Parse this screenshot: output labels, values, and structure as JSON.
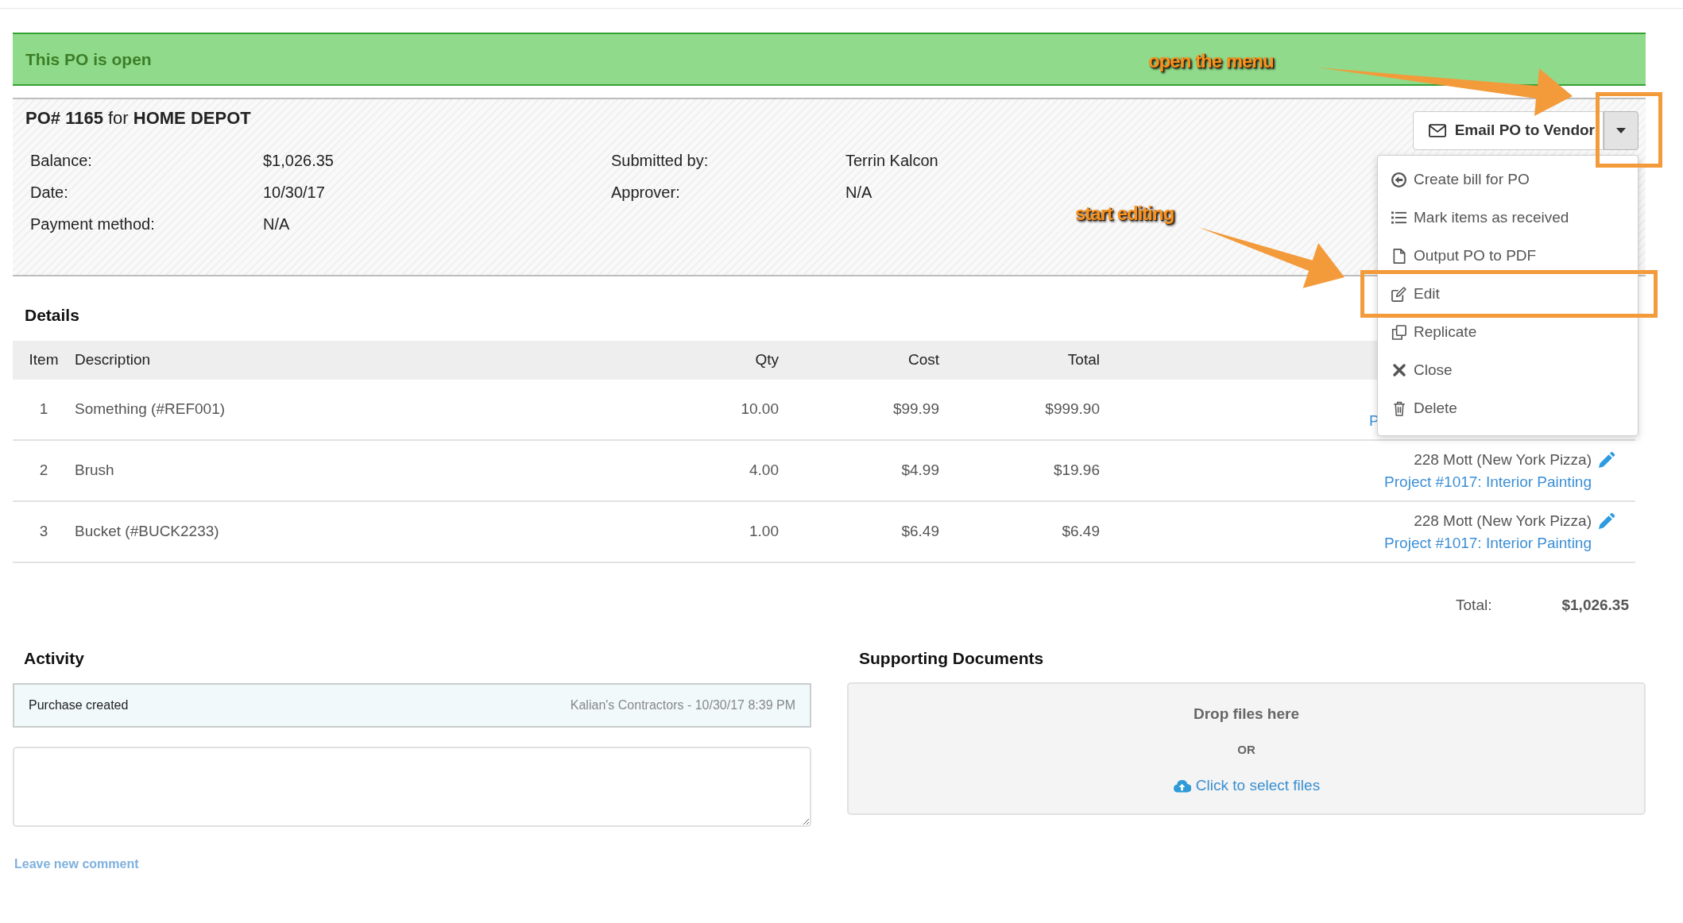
{
  "banner": {
    "text": "This PO is open"
  },
  "header": {
    "title": "**PO# 1165** for **HOME DEPOT**",
    "fields_left": [
      {
        "label": "Balance:",
        "value": "$1,026.35"
      },
      {
        "label": "Date:",
        "value": "10/30/17"
      },
      {
        "label": "Payment method:",
        "value": "N/A"
      }
    ],
    "fields_right": [
      {
        "label": "Submitted by:",
        "value": "Terrin Kalcon"
      },
      {
        "label": "Approver:",
        "value": "N/A"
      }
    ]
  },
  "actions": {
    "button": "Email PO to Vendor",
    "menu": {
      "expanded": true,
      "items": [
        "Create bill for PO",
        "Mark items as received",
        "Output PO to PDF",
        "Edit",
        "Replicate",
        "Close",
        "Delete"
      ]
    }
  },
  "details": {
    "title": "Details",
    "columns": [
      "Item",
      "Description",
      "Qty",
      "Cost",
      "Total"
    ],
    "rows": [
      {
        "item": "1",
        "description": "Something (#REF001)",
        "qty": "10.00",
        "cost": "$99.99",
        "total": "$999.90",
        "project": "P"
      },
      {
        "item": "2",
        "description": "Brush",
        "qty": "4.00",
        "cost": "$4.99",
        "total": "$19.96",
        "location": "228 Mott (New York Pizza)",
        "project": "Project #1017: Interior Painting"
      },
      {
        "item": "3",
        "description": "Bucket (#BUCK2233)",
        "qty": "1.00",
        "cost": "$6.49",
        "total": "$6.49",
        "location": "228 Mott (New York Pizza)",
        "project": "Project #1017: Interior Painting"
      }
    ],
    "total": {
      "label": "Total:",
      "value": "$1,026.35"
    }
  },
  "activity": {
    "title": "Activity",
    "entries": [
      {
        "text": "Purchase created",
        "meta": "Kalian's Contractors - 10/30/17 8:39 PM"
      }
    ],
    "comment_link": "Leave new comment"
  },
  "documents": {
    "title": "Supporting Documents",
    "dropzone": {
      "prompt": "Drop files here",
      "separator": "OR",
      "link": "Click to select files"
    }
  },
  "annotations": [
    {
      "text": "open the menu"
    },
    {
      "text": "start editing"
    }
  ]
}
